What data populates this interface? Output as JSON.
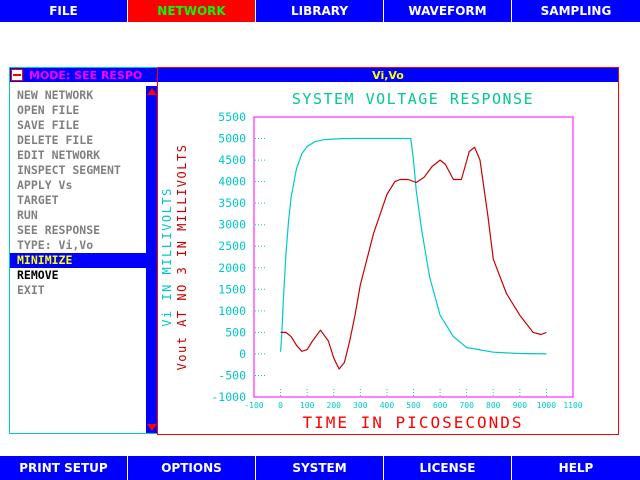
{
  "menubar": {
    "items": [
      {
        "label": "FILE"
      },
      {
        "label": "NETWORK",
        "active": true
      },
      {
        "label": "LIBRARY"
      },
      {
        "label": "WAVEFORM"
      },
      {
        "label": "SAMPLING"
      }
    ]
  },
  "mode_panel": {
    "title": "MODE: SEE RESPO",
    "items": [
      {
        "label": "NEW NETWORK"
      },
      {
        "label": "OPEN FILE"
      },
      {
        "label": "SAVE FILE"
      },
      {
        "label": "DELETE FILE"
      },
      {
        "label": "EDIT NETWORK"
      },
      {
        "label": "INSPECT SEGMENT"
      },
      {
        "label": "APPLY Vs"
      },
      {
        "label": "TARGET"
      },
      {
        "label": "RUN"
      },
      {
        "label": "SEE RESPONSE"
      },
      {
        "label": "TYPE: Vi,Vo"
      },
      {
        "label": "MINIMIZE",
        "selected": true
      },
      {
        "label": "REMOVE",
        "bright": true
      },
      {
        "label": "EXIT"
      }
    ]
  },
  "graph_window": {
    "title": "Vi,Vo"
  },
  "chart_data": {
    "type": "line",
    "title": "SYSTEM VOLTAGE RESPONSE",
    "xlabel": "TIME IN PICOSECONDS",
    "ylabel_1": "Vi IN MILLIVOLTS",
    "ylabel_2": "Vout AT NO 3 IN MILLIVOLTS",
    "xlim": [
      -100,
      1100
    ],
    "ylim": [
      -1000,
      5500
    ],
    "x_ticks": [
      -100,
      0,
      100,
      200,
      300,
      400,
      500,
      600,
      700,
      800,
      900,
      1000,
      1100
    ],
    "y_ticks": [
      5500,
      5000,
      4500,
      4000,
      3500,
      3000,
      2500,
      2000,
      1500,
      1000,
      500,
      0,
      -500,
      -1000
    ],
    "grid": false,
    "colors": {
      "title": "#00c896",
      "xlabel": "#ff0000",
      "ylabel_1": "#00c8c8",
      "ylabel_2": "#c80000",
      "frame": "#ff00ff",
      "ticks": "#00c8c8"
    },
    "series": [
      {
        "color": "#00c8c8",
        "x": [
          0,
          5,
          10,
          20,
          30,
          40,
          60,
          80,
          100,
          130,
          160,
          200,
          250,
          300,
          400,
          490,
          500,
          510,
          530,
          560,
          600,
          650,
          700,
          800,
          900,
          1000
        ],
        "y": [
          50,
          500,
          1200,
          2300,
          3100,
          3650,
          4300,
          4650,
          4820,
          4930,
          4970,
          4990,
          5000,
          5000,
          5000,
          5000,
          4500,
          3800,
          2900,
          1800,
          900,
          400,
          150,
          40,
          10,
          0
        ]
      },
      {
        "color": "#c80000",
        "x": [
          0,
          20,
          40,
          60,
          80,
          100,
          120,
          150,
          180,
          200,
          220,
          240,
          260,
          280,
          300,
          350,
          400,
          430,
          450,
          480,
          510,
          540,
          570,
          600,
          620,
          650,
          680,
          710,
          730,
          750,
          780,
          800,
          850,
          900,
          950,
          980,
          1000
        ],
        "y": [
          500,
          500,
          400,
          200,
          60,
          100,
          300,
          550,
          300,
          -100,
          -350,
          -200,
          300,
          900,
          1600,
          2800,
          3700,
          4000,
          4050,
          4050,
          3980,
          4100,
          4350,
          4500,
          4400,
          4050,
          4050,
          4700,
          4800,
          4500,
          3200,
          2200,
          1400,
          900,
          500,
          450,
          500
        ]
      }
    ]
  }
}
